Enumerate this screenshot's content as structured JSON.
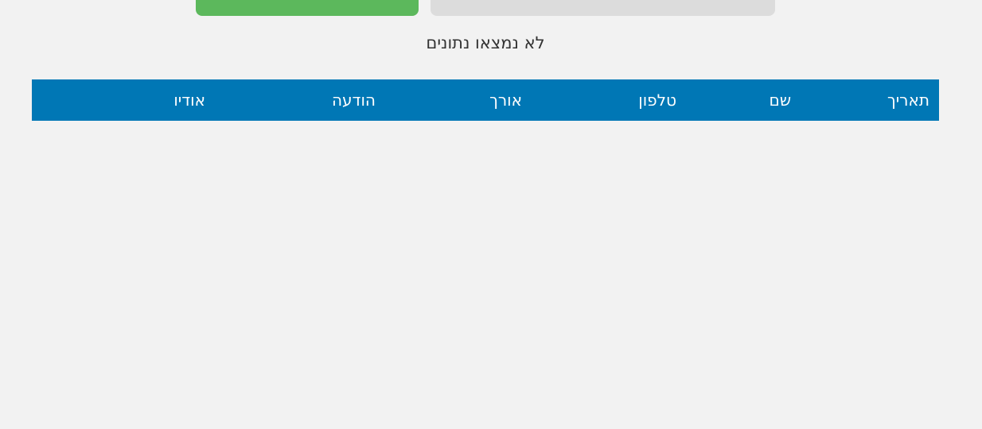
{
  "toolbar": {
    "export_button": {
      "color": "#5cb85c",
      "icon": "download-icon"
    },
    "filter_button": {
      "color": "#dcdcdc",
      "icon": "calendar-icon"
    }
  },
  "status": {
    "empty_message": "לא נמצאו נתונים"
  },
  "table": {
    "header_color": "#0077b5",
    "columns": [
      "תאריך",
      "שם",
      "טלפון",
      "אורך",
      "הודעה",
      "אודיו"
    ],
    "rows": []
  }
}
